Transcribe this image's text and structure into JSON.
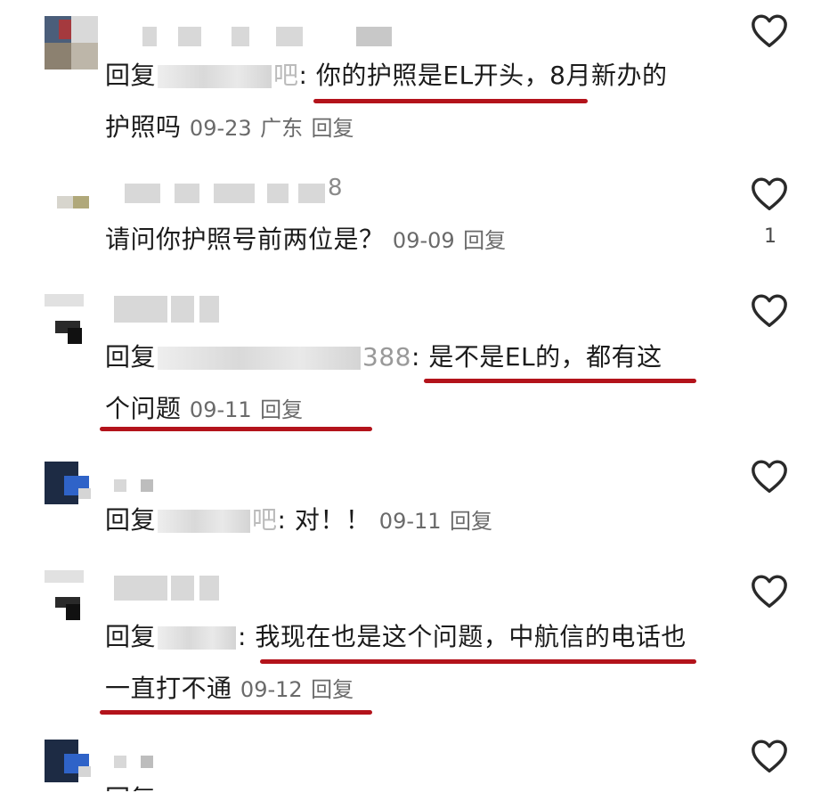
{
  "comments": [
    {
      "reply_prefix": "回复",
      "mention_tail": "吧",
      "colon": ":",
      "text": "你的护照是EL开头，8月新办的护照吗",
      "date": "09-23",
      "location": "广东",
      "reply_label": "回复",
      "likes": ""
    },
    {
      "name_tail": "8",
      "text": "请问你护照号前两位是？",
      "date": "09-09",
      "reply_label": "回复",
      "likes": "1"
    },
    {
      "reply_prefix": "回复",
      "mention_tail": "388",
      "colon": ":",
      "text": "是不是EL的，都有这个问题",
      "date": "09-11",
      "reply_label": "回复",
      "likes": ""
    },
    {
      "reply_prefix": "回复",
      "mention_tail": "吧",
      "colon": ":",
      "text": "对！！",
      "date": "09-11",
      "reply_label": "回复",
      "likes": ""
    },
    {
      "reply_prefix": "回复",
      "mention_tail": "",
      "colon": ":",
      "text": "我现在也是这个问题，中航信的电话也一直打不通",
      "date": "09-12",
      "reply_label": "回复",
      "likes": ""
    },
    {
      "reply_prefix": "回复",
      "text": "",
      "likes": ""
    }
  ],
  "colors": {
    "underline": "#b3131b",
    "text": "#1b1b1b",
    "meta": "#6a6a6a",
    "heart_stroke": "#2a2a2a"
  },
  "icons": {
    "like": "heart-outline-icon"
  }
}
